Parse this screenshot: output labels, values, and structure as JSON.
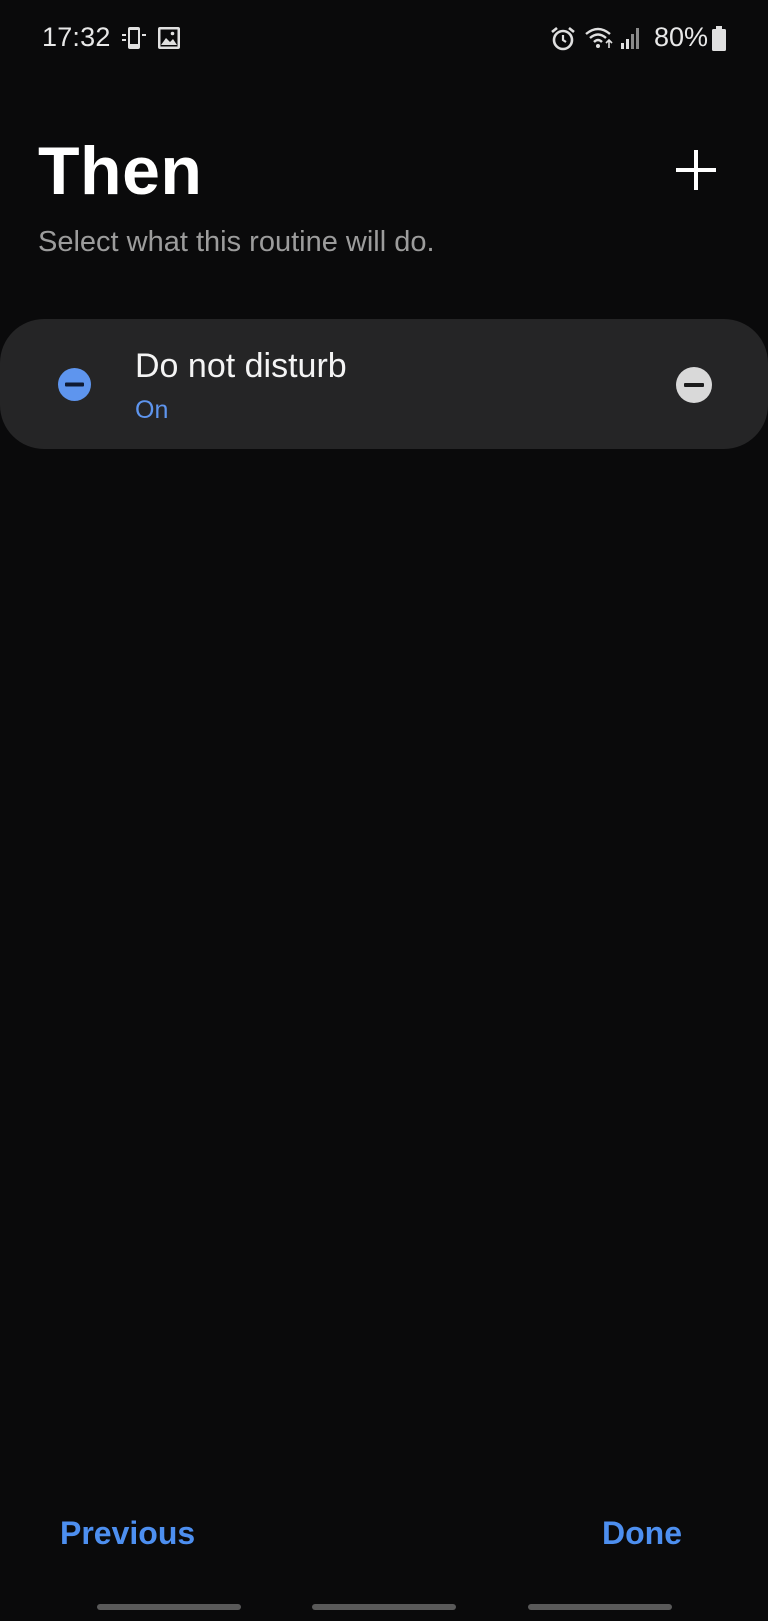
{
  "status_bar": {
    "time": "17:32",
    "battery": "80%",
    "icons": [
      "nfc-phone-icon",
      "image-icon",
      "alarm-icon",
      "wifi-icon",
      "signal-icon",
      "battery-icon"
    ]
  },
  "header": {
    "title": "Then",
    "subtitle": "Select what this routine will do.",
    "add_icon": "plus-icon"
  },
  "actions": [
    {
      "title": "Do not disturb",
      "status": "On",
      "status_color": "#5e95ee",
      "left_icon": "do-not-disturb-icon",
      "remove_icon": "minus-circle-icon"
    }
  ],
  "footer": {
    "previous_label": "Previous",
    "done_label": "Done",
    "accent_color": "#4d8ff0"
  }
}
